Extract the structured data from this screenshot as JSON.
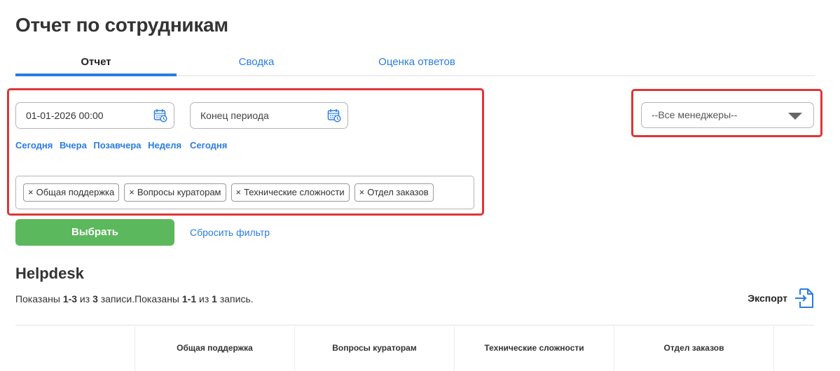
{
  "page": {
    "title": "Отчет по сотрудникам"
  },
  "tabs": [
    {
      "label": "Отчет",
      "active": true
    },
    {
      "label": "Сводка",
      "active": false
    },
    {
      "label": "Оценка ответов",
      "active": false
    }
  ],
  "filters": {
    "date_start": {
      "value": "01-01-2026 00:00"
    },
    "date_end": {
      "placeholder": "Конец периода"
    },
    "quick_start": [
      "Сегодня",
      "Вчера",
      "Позавчера",
      "Неделя"
    ],
    "quick_end": [
      "Сегодня"
    ],
    "tags": [
      "Общая поддержка",
      "Вопросы кураторам",
      "Технические сложности",
      "Отдел заказов"
    ],
    "tag_remove_glyph": "×",
    "manager_select": {
      "value": "--Все менеджеры--"
    },
    "submit_label": "Выбрать",
    "reset_label": "Сбросить фильтр"
  },
  "section": {
    "title": "Helpdesk",
    "summary": {
      "p1": "Показаны ",
      "r1": "1-3",
      "p2": " из ",
      "t1": "3",
      "p3": " записи.Показаны ",
      "r2": "1-1",
      "p4": " из ",
      "t2": "1",
      "p5": " запись."
    },
    "export_label": "Экспорт"
  },
  "table": {
    "columns": [
      "Общая поддержка",
      "Вопросы кураторам",
      "Технические сложности",
      "Отдел заказов"
    ]
  },
  "colors": {
    "accent": "#2a7de1",
    "success": "#5cb85c",
    "highlight": "#e03535"
  }
}
